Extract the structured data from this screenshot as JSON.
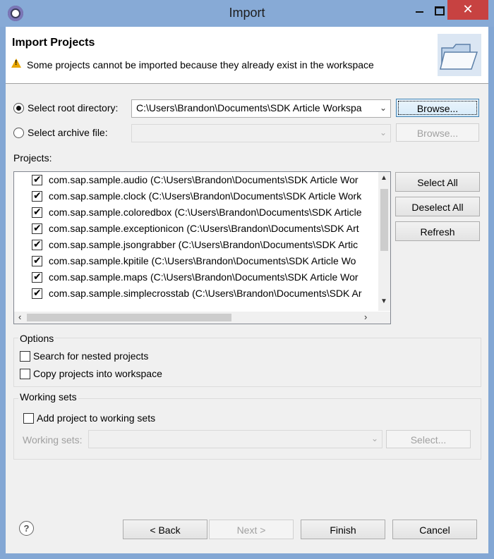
{
  "window": {
    "title": "Import",
    "close_glyph": "✕"
  },
  "banner": {
    "title": "Import Projects",
    "message": "Some projects cannot be imported because they already exist in the workspace"
  },
  "source": {
    "root_label": "Select root directory:",
    "root_value": "C:\\Users\\Brandon\\Documents\\SDK Article Workspa",
    "root_selected": true,
    "archive_label": "Select archive file:",
    "archive_value": "",
    "browse_label": "Browse...",
    "browse2_label": "Browse..."
  },
  "projects": {
    "label": "Projects:",
    "items": [
      {
        "text": "com.sap.sample.audio (C:\\Users\\Brandon\\Documents\\SDK Article Wor",
        "checked": true
      },
      {
        "text": "com.sap.sample.clock (C:\\Users\\Brandon\\Documents\\SDK Article Work",
        "checked": true
      },
      {
        "text": "com.sap.sample.coloredbox (C:\\Users\\Brandon\\Documents\\SDK Article",
        "checked": true
      },
      {
        "text": "com.sap.sample.exceptionicon (C:\\Users\\Brandon\\Documents\\SDK Art",
        "checked": true
      },
      {
        "text": "com.sap.sample.jsongrabber (C:\\Users\\Brandon\\Documents\\SDK Artic",
        "checked": true
      },
      {
        "text": "com.sap.sample.kpitile (C:\\Users\\Brandon\\Documents\\SDK Article Wo",
        "checked": true
      },
      {
        "text": "com.sap.sample.maps (C:\\Users\\Brandon\\Documents\\SDK Article Wor",
        "checked": true
      },
      {
        "text": "com.sap.sample.simplecrosstab (C:\\Users\\Brandon\\Documents\\SDK Ar",
        "checked": true
      }
    ],
    "select_all": "Select All",
    "deselect_all": "Deselect All",
    "refresh": "Refresh"
  },
  "options": {
    "title": "Options",
    "nested": "Search for nested projects",
    "copy": "Copy projects into workspace"
  },
  "working_sets": {
    "title": "Working sets",
    "add_label": "Add project to working sets",
    "sets_label": "Working sets:",
    "select_label": "Select..."
  },
  "footer": {
    "help_glyph": "?",
    "back": "< Back",
    "next": "Next >",
    "finish": "Finish",
    "cancel": "Cancel"
  }
}
